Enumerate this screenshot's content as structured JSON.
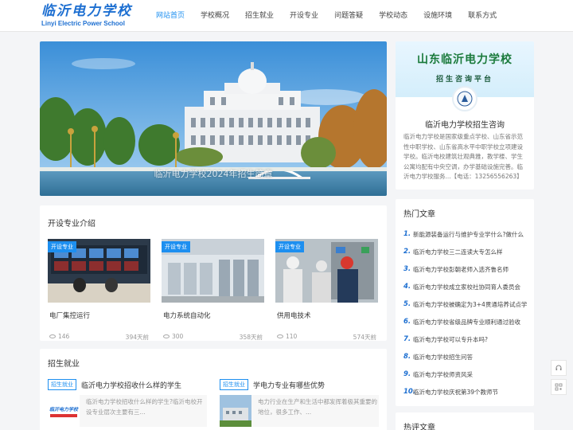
{
  "site": {
    "logo_cn": "临沂电力学校",
    "logo_en": "Linyi Electric Power School"
  },
  "nav": {
    "items": [
      {
        "label": "网站首页",
        "active": true
      },
      {
        "label": "学校概况"
      },
      {
        "label": "招生就业"
      },
      {
        "label": "开设专业"
      },
      {
        "label": "问题答疑"
      },
      {
        "label": "学校动态"
      },
      {
        "label": "设施环境"
      },
      {
        "label": "联系方式"
      }
    ]
  },
  "slider": {
    "caption": "临沂电力学校2024年招生简章"
  },
  "majors": {
    "title": "开设专业介绍",
    "items": [
      {
        "tag": "开设专业",
        "name": "电厂集控运行",
        "views": "146",
        "time": "394天前"
      },
      {
        "tag": "开设专业",
        "name": "电力系统自动化",
        "views": "300",
        "time": "358天前"
      },
      {
        "tag": "开设专业",
        "name": "供用电技术",
        "views": "110",
        "time": "574天前"
      }
    ]
  },
  "jobs": {
    "title": "招生就业",
    "items": [
      {
        "tag": "招生就业",
        "title": "临沂电力学校招收什么样的学生",
        "excerpt": "临沂电力学校招收什么样的学生?临沂电校开设专业层次主要有三...",
        "thumb_text": "临沂电力学校"
      },
      {
        "tag": "招生就业",
        "title": "学电力专业有哪些优势",
        "excerpt": "电力行业在生产和生活中都发挥着极其重要的地位，很多工作、..."
      }
    ]
  },
  "profile": {
    "banner_title": "山东临沂电力学校",
    "banner_sub": "招生咨询平台",
    "name": "临沂电力学校招生咨询",
    "desc": "临沂电力学校是国家级重点学校、山东省示范性中职学校、山东省高水平中职学校立项建设学校。临沂电校建筑壮观典雅，教学楼、学生公寓均配有中央空调，办学基础设施完善。临沂电力学校服务...【电话：13256556263】"
  },
  "hot": {
    "title": "热门文章",
    "items": [
      {
        "num": "1.",
        "text": "新能源装备运行与维护专业学什么?做什么"
      },
      {
        "num": "2.",
        "text": "临沂电力学校三二连读大专怎么样"
      },
      {
        "num": "3.",
        "text": "临沂电力学校彭朝老师入选齐鲁名师"
      },
      {
        "num": "4.",
        "text": "临沂电力学校成立家校社协同育人委员会"
      },
      {
        "num": "5.",
        "text": "临沂电力学校被确定为3+4贯通培养试点学"
      },
      {
        "num": "6.",
        "text": "临沂电力学校省级品牌专业顺利通过验收"
      },
      {
        "num": "7.",
        "text": "临沂电力学校可以专升本吗?"
      },
      {
        "num": "8.",
        "text": "临沂电力学校招生问答"
      },
      {
        "num": "9.",
        "text": "临沂电力学校师资风采"
      },
      {
        "num": "10.",
        "text": "临沂电力学校庆祝第39个教师节"
      }
    ]
  },
  "comments": {
    "title": "热评文章"
  },
  "colors": {
    "accent": "#1d8ff0",
    "logo": "#1d6fd1"
  }
}
